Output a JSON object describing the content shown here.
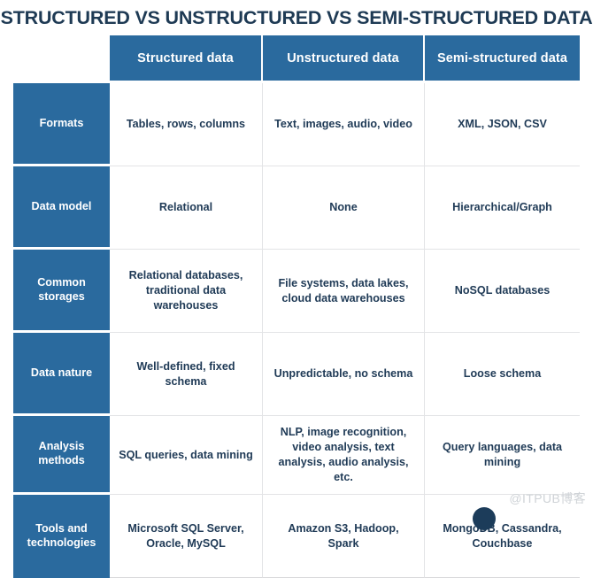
{
  "page": {
    "title": "STRUCTURED VS UNSTRUCTURED VS SEMI-STRUCTURED DATA",
    "watermark": "@ITPUB博客"
  },
  "colors": {
    "header_blue": "#2a6a9e",
    "row_label_blue": "#2a6a9e",
    "title_navy": "#1e3a54",
    "cell_text_navy": "#1f3a56",
    "grid_line": "#e3e4e6",
    "background": "#ffffff",
    "watermark_gray": "#cfd3d7"
  },
  "table": {
    "corner_label": "",
    "columns": [
      "Structured data",
      "Unstructured data",
      "Semi-structured data"
    ],
    "rows": [
      {
        "label": "Formats",
        "cells": [
          "Tables, rows, columns",
          "Text, images, audio, video",
          "XML, JSON, CSV"
        ]
      },
      {
        "label": "Data model",
        "cells": [
          "Relational",
          "None",
          "Hierarchical/Graph"
        ]
      },
      {
        "label": "Common storages",
        "cells": [
          "Relational databases, traditional data warehouses",
          "File systems, data lakes, cloud data warehouses",
          "NoSQL databases"
        ]
      },
      {
        "label": "Data nature",
        "cells": [
          "Well-defined, fixed schema",
          "Unpredictable, no schema",
          "Loose schema"
        ]
      },
      {
        "label": "Analysis methods",
        "cells": [
          "SQL queries, data mining",
          "NLP, image recognition, video analysis, text analysis, audio analysis, etc.",
          "Query languages, data mining"
        ]
      },
      {
        "label": "Tools and technologies",
        "cells": [
          "Microsoft SQL Server, Oracle, MySQL",
          "Amazon S3, Hadoop, Spark",
          "MongoDB, Cassandra, Couchbase"
        ]
      }
    ]
  }
}
